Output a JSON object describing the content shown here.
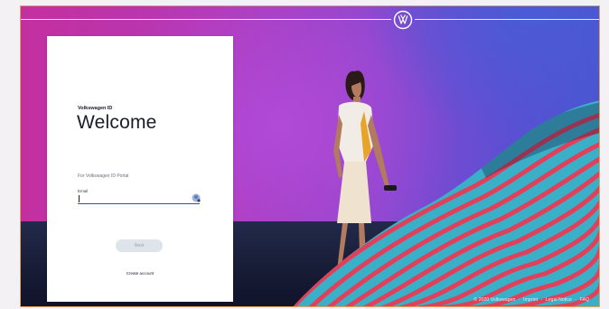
{
  "header": {
    "logo_icon": "vw-logo-icon"
  },
  "login_card": {
    "brand": "Volkswagen ID",
    "title": "Welcome",
    "subtitle": "For Volkswagen ID Portal",
    "email_label": "Email",
    "email_value": "",
    "next_label": "Next",
    "create_account_label": "Create account",
    "email_icon": "autofill-key-icon"
  },
  "footer": {
    "copyright": "© 2020 Volkswagen",
    "sep1": "·",
    "imprint": "Imprint",
    "sep2": "·",
    "legal_notice": "Legal Notice",
    "sep3": "·",
    "faq": "FAQ"
  },
  "colors": {
    "accent": "#3d4f9e",
    "button_bg": "#dfe4ea",
    "button_text": "#9aa2ad",
    "text_dark": "#1b1b2e"
  }
}
